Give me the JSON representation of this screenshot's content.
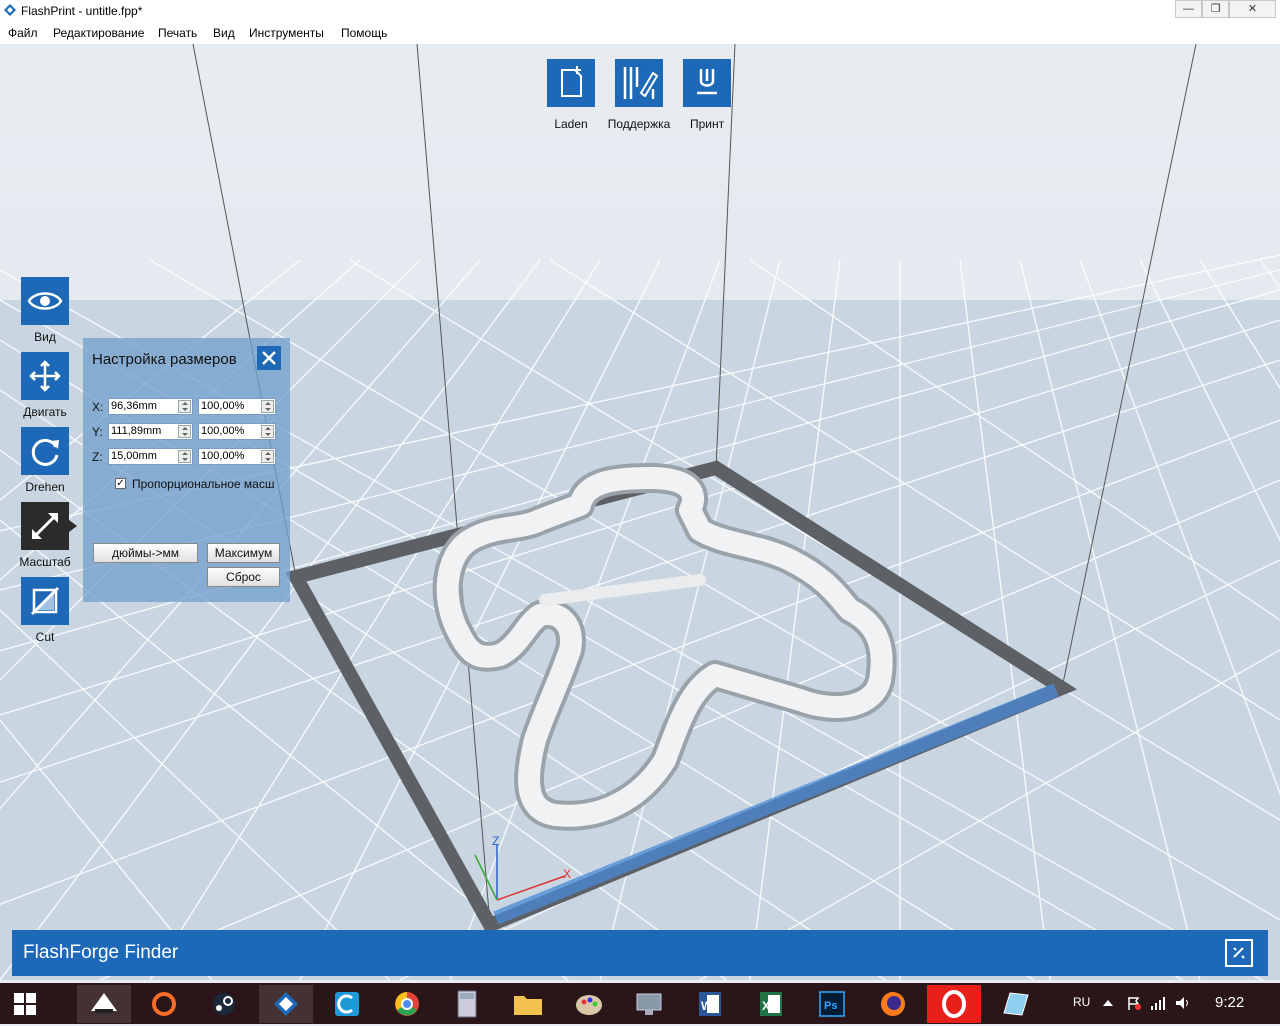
{
  "window": {
    "title": "FlashPrint - untitle.fpp*",
    "controls": {
      "minimize": "—",
      "maximize": "❐",
      "close": "✕"
    }
  },
  "menu": [
    "Файл",
    "Редактирование",
    "Печать",
    "Вид",
    "Инструменты",
    "Помощь"
  ],
  "top_toolbar": [
    {
      "label": "Laden",
      "icon": "file-add-icon"
    },
    {
      "label": "Поддержка",
      "icon": "support-edit-icon"
    },
    {
      "label": "Принт",
      "icon": "print-icon"
    }
  ],
  "left_toolbar": [
    {
      "label": "Вид",
      "icon": "eye-icon"
    },
    {
      "label": "Двигать",
      "icon": "move-icon"
    },
    {
      "label": "Drehen",
      "icon": "rotate-icon"
    },
    {
      "label": "Масштаб",
      "icon": "scale-icon",
      "active": true
    },
    {
      "label": "Cut",
      "icon": "cut-icon"
    }
  ],
  "scale_panel": {
    "title": "Настройка размеров",
    "rows": [
      {
        "axis": "X:",
        "size": "96,36mm",
        "percent": "100,00%"
      },
      {
        "axis": "Y:",
        "size": "111,89mm",
        "percent": "100,00%"
      },
      {
        "axis": "Z:",
        "size": "15,00mm",
        "percent": "100,00%"
      }
    ],
    "proportional_label": "Пропорциональное масш",
    "proportional_checked": true,
    "buttons": {
      "inch_to_mm": "дюймы->мм",
      "max": "Максимум",
      "reset": "Сброс"
    }
  },
  "axes": {
    "x": "X",
    "z": "Z"
  },
  "brand_bar": {
    "title": "FlashForge Finder"
  },
  "taskbar": {
    "language": "RU",
    "time": "9:22",
    "apps": [
      "windows-start-icon",
      "inkscape-icon",
      "origin-icon",
      "steam-icon",
      "flashprint-icon",
      "ccleaner-icon",
      "chrome-icon",
      "calculator-icon",
      "file-explorer-icon",
      "paint-icon",
      "network-icon",
      "word-icon",
      "excel-icon",
      "photoshop-icon",
      "firefox-icon",
      "opera-icon",
      "notes-icon"
    ]
  },
  "colors": {
    "accent": "#1d69b7",
    "active_tool": "#2b2b2b",
    "taskbar": "#2a1518"
  }
}
